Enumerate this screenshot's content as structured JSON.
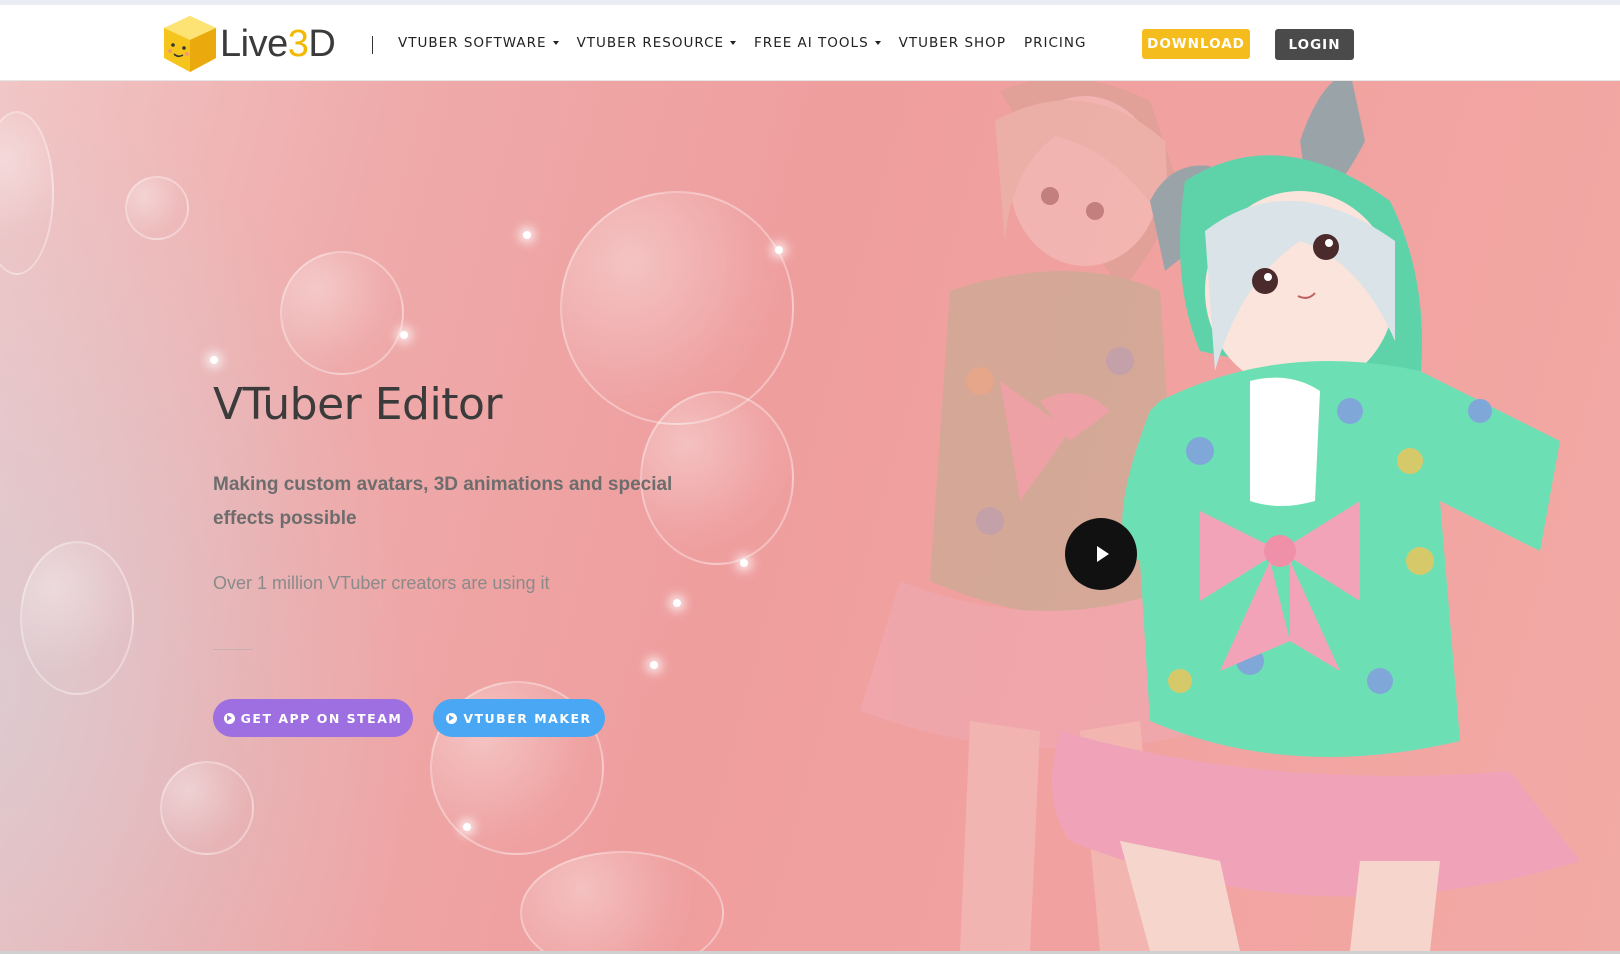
{
  "brand": {
    "logo_text_prefix": "Live",
    "logo_text_highlight": "3",
    "logo_text_suffix": "D",
    "accent_color": "#f4bc1c"
  },
  "nav": {
    "items": [
      {
        "label": "VTUBER SOFTWARE",
        "has_dropdown": true
      },
      {
        "label": "VTUBER RESOURCE",
        "has_dropdown": true
      },
      {
        "label": "FREE AI TOOLS",
        "has_dropdown": true
      },
      {
        "label": "VTUBER SHOP",
        "has_dropdown": false
      },
      {
        "label": "PRICING",
        "has_dropdown": false
      }
    ],
    "download_label": "DOWNLOAD",
    "login_label": "LOGIN"
  },
  "hero": {
    "title": "VTuber Editor",
    "subtitle": "Making custom avatars, 3D animations and special effects possible",
    "note": "Over 1 million VTuber creators are using it",
    "primary_button": "GET APP ON STEAM",
    "secondary_button": "VTUBER MAKER",
    "primary_color": "#9d6fe0",
    "secondary_color": "#49a7f4",
    "play_icon": "play-icon"
  }
}
